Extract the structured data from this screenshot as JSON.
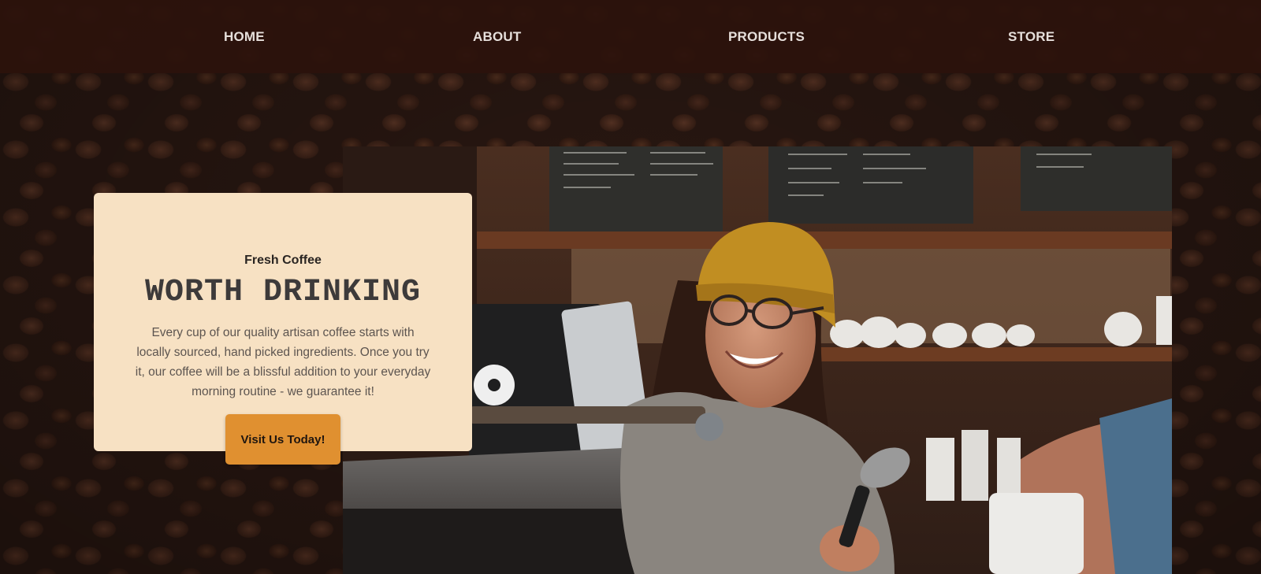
{
  "nav": {
    "items": [
      {
        "label": "HOME"
      },
      {
        "label": "ABOUT"
      },
      {
        "label": "PRODUCTS"
      },
      {
        "label": "STORE"
      }
    ]
  },
  "intro": {
    "subheading": "Fresh Coffee",
    "heading": "WORTH DRINKING",
    "body": "Every cup of our quality artisan coffee starts with locally sourced, hand picked ingredients. Once you try it, our coffee will be a blissful addition to your everyday morning routine - we guarantee it!",
    "cta_label": "Visit Us Today!"
  },
  "colors": {
    "nav_bg": "#2c120c",
    "card_bg": "#f7e1c3",
    "accent": "#e09030"
  },
  "photo": {
    "alt": "Smiling barista in a yellow beanie at a coffee counter"
  }
}
